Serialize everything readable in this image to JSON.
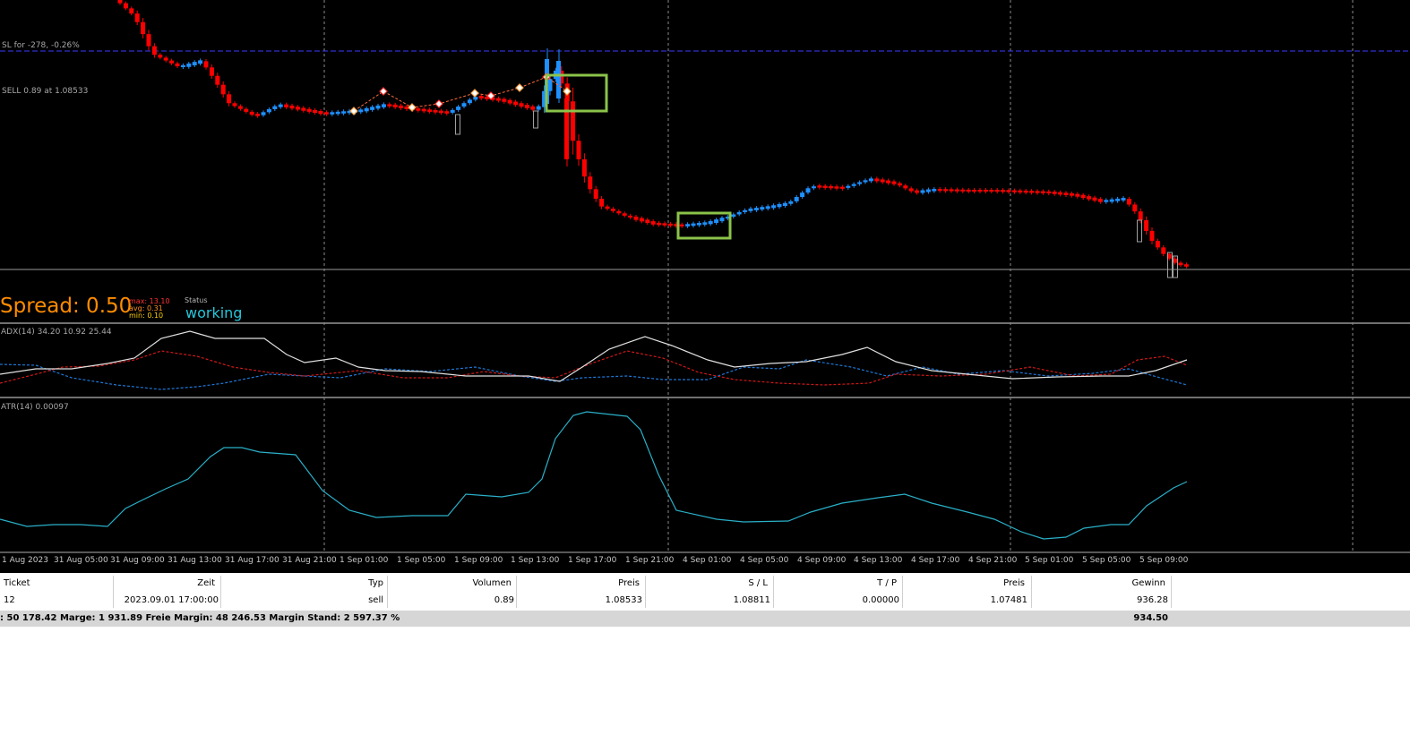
{
  "chart": {
    "sl_label": "SL for -278, -0.26%",
    "order_label": "SELL 0.89 at 1.08533",
    "spread_label": "Spread: 0.50",
    "spread_max": "max: 13.10",
    "spread_avg": "avg: 0.31",
    "spread_min": "min: 0.10",
    "status_title": "Status",
    "status_value": "working",
    "adx_label": "ADX(14) 34.20 10.92 25.44",
    "atr_label": "ATR(14) 0.00097",
    "time_labels": [
      "1 Aug 2023",
      "31 Aug 05:00",
      "31 Aug 09:00",
      "31 Aug 13:00",
      "31 Aug 17:00",
      "31 Aug 21:00",
      "1 Sep 01:00",
      "1 Sep 05:00",
      "1 Sep 09:00",
      "1 Sep 13:00",
      "1 Sep 17:00",
      "1 Sep 21:00",
      "4 Sep 01:00",
      "4 Sep 05:00",
      "4 Sep 09:00",
      "4 Sep 13:00",
      "4 Sep 17:00",
      "4 Sep 21:00",
      "5 Sep 01:00",
      "5 Sep 05:00",
      "5 Sep 09:00"
    ],
    "colors": {
      "bull": "#1e90ff",
      "bear": "#ff0000",
      "highlight": "#8bc34a",
      "adx": "#e0e0e0",
      "plus_di": "#1e78d8",
      "minus_di": "#d01818",
      "atr": "#2ab0c8",
      "spread": "#ff8c00",
      "status": "#26c6da"
    }
  },
  "table": {
    "headers": [
      "Ticket",
      "Zeit",
      "Typ",
      "Volumen",
      "Preis",
      "S / L",
      "T / P",
      "Preis",
      "Gewinn"
    ],
    "row": [
      "12",
      "2023.09.01 17:00:00",
      "sell",
      "0.89",
      "1.08533",
      "1.08811",
      "0.00000",
      "1.07481",
      "936.28"
    ]
  },
  "summary": {
    "text": ": 50 178.42  Marge: 1 931.89  Freie Margin: 48 246.53  Margin Stand: 2 597.37 %",
    "profit": "934.50"
  }
}
